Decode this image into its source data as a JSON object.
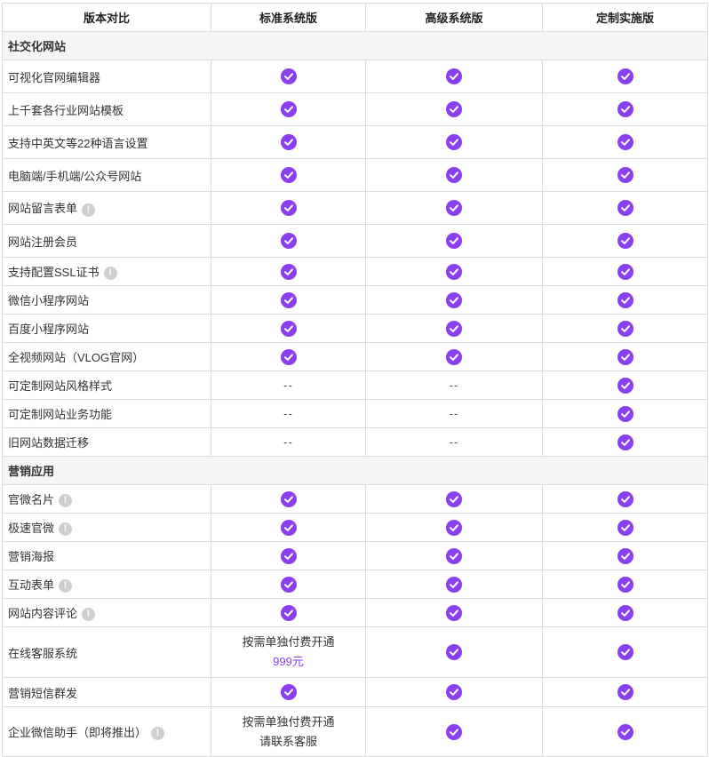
{
  "header": {
    "col1": "版本对比",
    "col2": "标准系统版",
    "col3": "高级系统版",
    "col4": "定制实施版"
  },
  "colors": {
    "accent": "#8a3ff0",
    "info_icon": "#cfcfcf",
    "section_bg": "#f5f5f5"
  },
  "sections": [
    {
      "title": "社交化网站",
      "rows": [
        {
          "label": "可视化官网编辑器",
          "info": false,
          "std": "check",
          "adv": "check",
          "custom": "check"
        },
        {
          "label": "上千套各行业网站模板",
          "info": false,
          "std": "check",
          "adv": "check",
          "custom": "check"
        },
        {
          "label": "支持中英文等22种语言设置",
          "info": false,
          "std": "check",
          "adv": "check",
          "custom": "check"
        },
        {
          "label": "电脑端/手机端/公众号网站",
          "info": false,
          "std": "check",
          "adv": "check",
          "custom": "check"
        },
        {
          "label": "网站留言表单",
          "info": true,
          "std": "check",
          "adv": "check",
          "custom": "check"
        },
        {
          "label": "网站注册会员",
          "info": false,
          "std": "check",
          "adv": "check",
          "custom": "check"
        },
        {
          "label": "支持配置SSL证书",
          "info": true,
          "std": "check",
          "adv": "check",
          "custom": "check"
        },
        {
          "label": "微信小程序网站",
          "info": false,
          "std": "check",
          "adv": "check",
          "custom": "check"
        },
        {
          "label": "百度小程序网站",
          "info": false,
          "std": "check",
          "adv": "check",
          "custom": "check"
        },
        {
          "label": "全视频网站（VLOG官网）",
          "info": false,
          "std": "check",
          "adv": "check",
          "custom": "check"
        },
        {
          "label": "可定制网站风格样式",
          "info": false,
          "std": "--",
          "adv": "--",
          "custom": "check"
        },
        {
          "label": "可定制网站业务功能",
          "info": false,
          "std": "--",
          "adv": "--",
          "custom": "check"
        },
        {
          "label": "旧网站数据迁移",
          "info": false,
          "std": "--",
          "adv": "--",
          "custom": "check"
        }
      ]
    },
    {
      "title": "营销应用",
      "rows": [
        {
          "label": "官微名片",
          "info": true,
          "std": "check",
          "adv": "check",
          "custom": "check"
        },
        {
          "label": "极速官微",
          "info": true,
          "std": "check",
          "adv": "check",
          "custom": "check"
        },
        {
          "label": "营销海报",
          "info": false,
          "std": "check",
          "adv": "check",
          "custom": "check"
        },
        {
          "label": "互动表单",
          "info": true,
          "std": "check",
          "adv": "check",
          "custom": "check"
        },
        {
          "label": "网站内容评论",
          "info": true,
          "std": "check",
          "adv": "check",
          "custom": "check"
        },
        {
          "label": "在线客服系统",
          "info": false,
          "std": {
            "line1": "按需单独付费开通",
            "line2": "999元",
            "line2_price": true
          },
          "adv": "check",
          "custom": "check"
        },
        {
          "label": "营销短信群发",
          "info": false,
          "std": "check",
          "adv": "check",
          "custom": "check"
        },
        {
          "label": "企业微信助手（即将推出）",
          "info": true,
          "std": {
            "line1": "按需单独付费开通",
            "line2": "请联系客服",
            "line2_price": false
          },
          "adv": "check",
          "custom": "check"
        }
      ]
    }
  ]
}
